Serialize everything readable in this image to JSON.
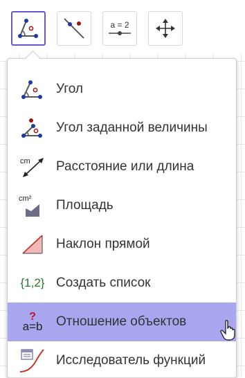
{
  "toolbar": {
    "buttons": [
      {
        "icon": "angle-icon",
        "active": true
      },
      {
        "icon": "line-point-icon",
        "active": false
      },
      {
        "icon": "slider-icon",
        "label": "a = 2",
        "active": false
      },
      {
        "icon": "move-icon",
        "active": false
      }
    ]
  },
  "menu": {
    "items": [
      {
        "icon": "angle-icon",
        "label": "Угол"
      },
      {
        "icon": "angle-given-size-icon",
        "label": "Угол заданной величины"
      },
      {
        "icon": "distance-length-icon",
        "icon_text": "cm",
        "label": "Расстояние или длина"
      },
      {
        "icon": "area-icon",
        "icon_text": "cm²",
        "label": "Площадь"
      },
      {
        "icon": "slope-icon",
        "label": "Наклон прямой"
      },
      {
        "icon": "create-list-icon",
        "icon_text": "{1,2}",
        "label": "Создать список"
      },
      {
        "icon": "relation-icon",
        "icon_text_top": "?",
        "icon_text": "a=b",
        "label": "Отношение объектов",
        "hover": true
      },
      {
        "icon": "function-inspector-icon",
        "label": "Исследователь функций"
      }
    ]
  },
  "colors": {
    "accent": "#6557d2",
    "hover_bg": "#a9a6f0",
    "point_blue": "#1a3aa8",
    "point_red": "#a01010",
    "list_green": "#2a7a2a",
    "relation_red": "#c4162a"
  }
}
